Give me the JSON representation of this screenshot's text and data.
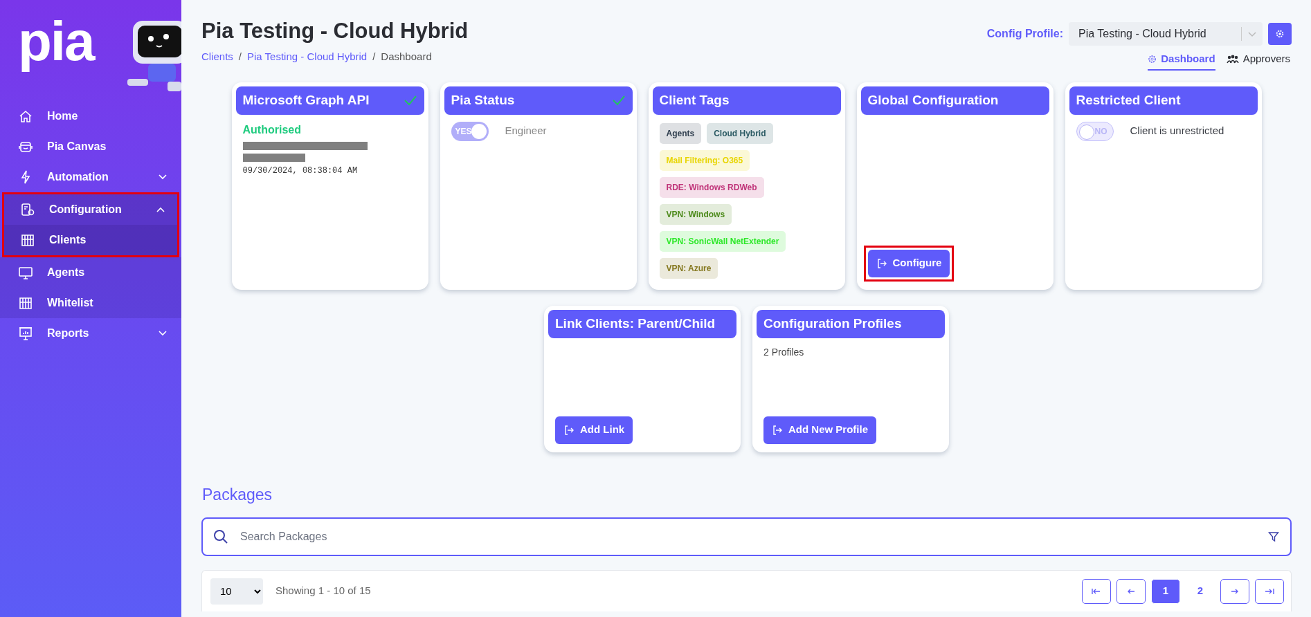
{
  "sidebar": {
    "logo_text": "pia",
    "items": [
      {
        "label": "Home",
        "expandable": false,
        "expanded": false,
        "selected": false,
        "highlighted": false
      },
      {
        "label": "Pia Canvas",
        "expandable": false,
        "expanded": false,
        "selected": false,
        "highlighted": false
      },
      {
        "label": "Automation",
        "expandable": true,
        "expanded": false,
        "selected": false,
        "highlighted": false
      },
      {
        "label": "Configuration",
        "expandable": true,
        "expanded": true,
        "selected": false,
        "highlighted": true,
        "children": [
          {
            "label": "Clients",
            "selected": true,
            "highlighted": true
          },
          {
            "label": "Agents",
            "selected": false,
            "highlighted": false
          },
          {
            "label": "Whitelist",
            "selected": false,
            "highlighted": false
          }
        ]
      },
      {
        "label": "Reports",
        "expandable": true,
        "expanded": false,
        "selected": false,
        "highlighted": false
      }
    ]
  },
  "header": {
    "title": "Pia Testing - Cloud Hybrid",
    "breadcrumb_separator": "/",
    "breadcrumbs": [
      {
        "label": "Clients",
        "link": true
      },
      {
        "label": "Pia Testing - Cloud Hybrid",
        "link": true
      },
      {
        "label": "Dashboard",
        "link": false
      }
    ],
    "config_profile": {
      "label": "Config Profile:",
      "value": "Pia Testing - Cloud Hybrid"
    },
    "view_tabs": [
      {
        "label": "Dashboard",
        "selected": true
      },
      {
        "label": "Approvers",
        "selected": false
      }
    ]
  },
  "cards": [
    {
      "kind": "auth",
      "title": "Microsoft Graph API",
      "checked": true,
      "status": "Authorised",
      "timestamp": "09/30/2024, 08:38:04 AM"
    },
    {
      "kind": "toggle",
      "title": "Pia Status",
      "checked": true,
      "toggle": {
        "on": true,
        "label": "YES"
      },
      "text": "Engineer"
    },
    {
      "kind": "tags",
      "title": "Client Tags",
      "checked": false,
      "tags": [
        {
          "label": "Agents",
          "color": "#2f3e4e"
        },
        {
          "label": "Cloud Hybrid",
          "color": "#2b5a63"
        },
        {
          "label": "Mail Filtering: O365",
          "color": "#e8d500"
        },
        {
          "label": "RDE: Windows RDWeb",
          "color": "#c0357a"
        },
        {
          "label": "VPN: Windows",
          "color": "#4d8a1b"
        },
        {
          "label": "VPN: SonicWall NetExtender",
          "color": "#2ee82a"
        },
        {
          "label": "VPN: Azure",
          "color": "#85781f"
        }
      ]
    },
    {
      "kind": "action",
      "title": "Global Configuration",
      "checked": false,
      "button": {
        "label": "Configure",
        "highlighted": true
      }
    },
    {
      "kind": "toggle",
      "title": "Restricted Client",
      "checked": false,
      "toggle": {
        "on": false,
        "label": "NO"
      },
      "text": "Client is unrestricted"
    }
  ],
  "cards_row_2": [
    {
      "kind": "action",
      "title": "Link Clients: Parent/Child",
      "checked": false,
      "button": {
        "label": "Add Link",
        "highlighted": false
      }
    },
    {
      "kind": "action",
      "title": "Configuration Profiles",
      "checked": false,
      "text": "2 Profiles",
      "button": {
        "label": "Add New Profile",
        "highlighted": false
      }
    }
  ],
  "packages": {
    "title": "Packages",
    "search": {
      "placeholder": "Search Packages"
    },
    "page_size": "10",
    "showing": "Showing 1 - 10 of 15",
    "pages": [
      {
        "label": "1",
        "selected": true
      },
      {
        "label": "2",
        "selected": false
      }
    ]
  }
}
